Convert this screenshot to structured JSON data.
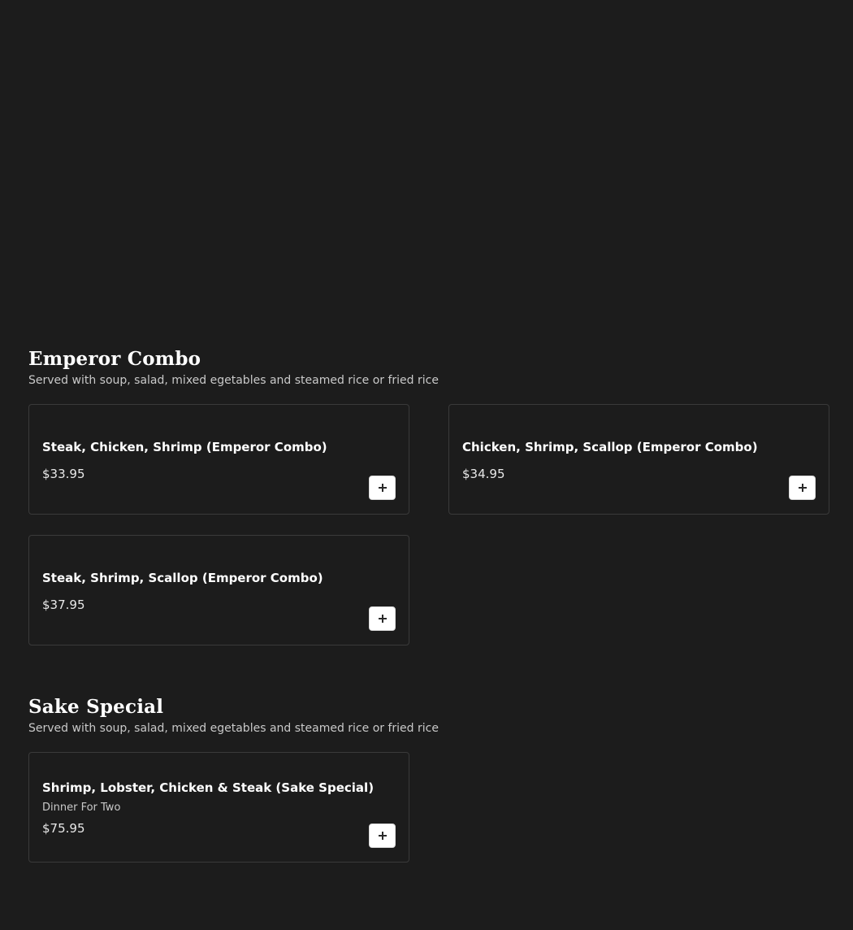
{
  "sections": [
    {
      "title": "Emperor Combo",
      "description": "Served with soup, salad, mixed egetables and steamed rice or fried rice",
      "items": [
        {
          "name": "Steak, Chicken, Shrimp (Emperor Combo)",
          "price": "$33.95"
        },
        {
          "name": "Chicken, Shrimp, Scallop (Emperor Combo)",
          "price": "$34.95"
        },
        {
          "name": "Steak, Shrimp, Scallop (Emperor Combo)",
          "price": "$37.95"
        }
      ]
    },
    {
      "title": "Sake Special",
      "description": "Served with soup, salad, mixed egetables and steamed rice or fried rice",
      "items": [
        {
          "name": "Shrimp, Lobster, Chicken & Steak (Sake Special)",
          "subtitle": "Dinner For Two",
          "price": "$75.95"
        }
      ]
    }
  ],
  "icons": {
    "add": "plus-icon"
  },
  "colors": {
    "background": "#1c1c1c",
    "card_border": "#3a3a3a",
    "button_bg": "#ffffff"
  }
}
